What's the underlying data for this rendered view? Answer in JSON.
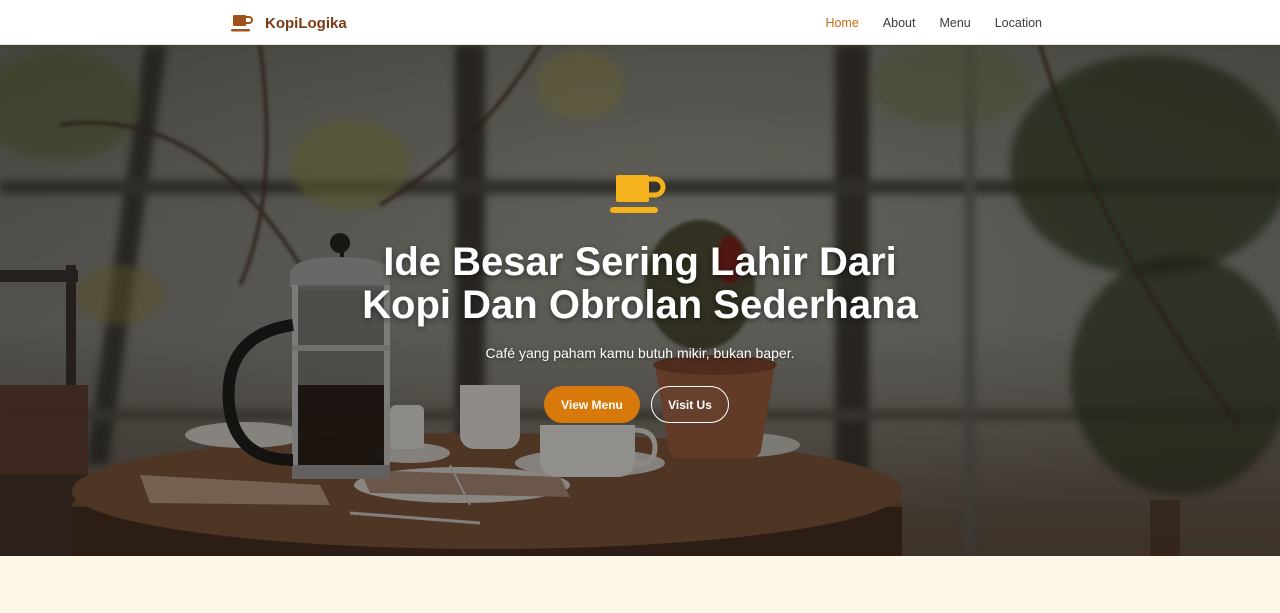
{
  "navbar": {
    "brand": {
      "name": "KopiLogika",
      "icon": "coffee-cup-icon"
    },
    "links": [
      {
        "label": "Home",
        "active": true
      },
      {
        "label": "About",
        "active": false
      },
      {
        "label": "Menu",
        "active": false
      },
      {
        "label": "Location",
        "active": false
      }
    ]
  },
  "hero": {
    "icon": "coffee-cup-icon",
    "title_line1": "Ide Besar Sering Lahir Dari",
    "title_line2": "Kopi Dan Obrolan Sederhana",
    "subtitle": "Café yang paham kamu butuh mikir, bukan baper.",
    "primary_button": "View Menu",
    "secondary_button": "Visit Us"
  },
  "colors": {
    "brand": "#7a3b12",
    "accent": "#d77a0b",
    "active_link": "#c46a10",
    "hero_icon": "#f6b21c",
    "section_bg": "#fef8e8"
  }
}
